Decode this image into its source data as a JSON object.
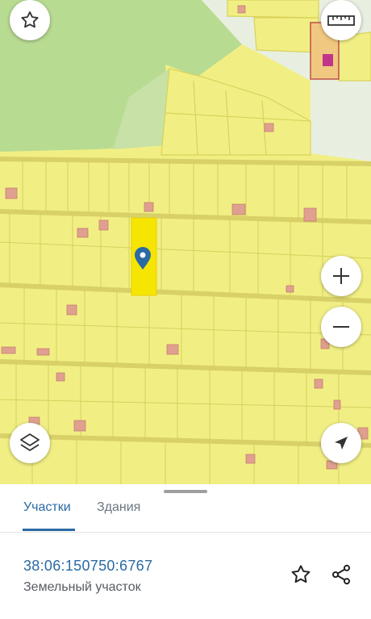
{
  "map": {
    "buttons": {
      "favorite": "star-icon",
      "ruler": "ruler-icon",
      "zoom_in": "plus-icon",
      "zoom_out": "minus-icon",
      "layers": "layers-icon",
      "location": "navigation-arrow-icon"
    },
    "colors": {
      "parcel": "#f1ef84",
      "parcel_border": "#d9d25a",
      "forest": "#b3d98e",
      "building": "#e0a090",
      "selected_parcel": "#f6e500",
      "marker": "#2a6aa4"
    }
  },
  "tabs": [
    {
      "label": "Участки",
      "active": true
    },
    {
      "label": "Здания",
      "active": false
    }
  ],
  "parcel": {
    "cadastral_number": "38:06:150750:6767",
    "type": "Земельный участок"
  },
  "actions": {
    "favorite": "star-outline-icon",
    "share": "share-icon"
  }
}
